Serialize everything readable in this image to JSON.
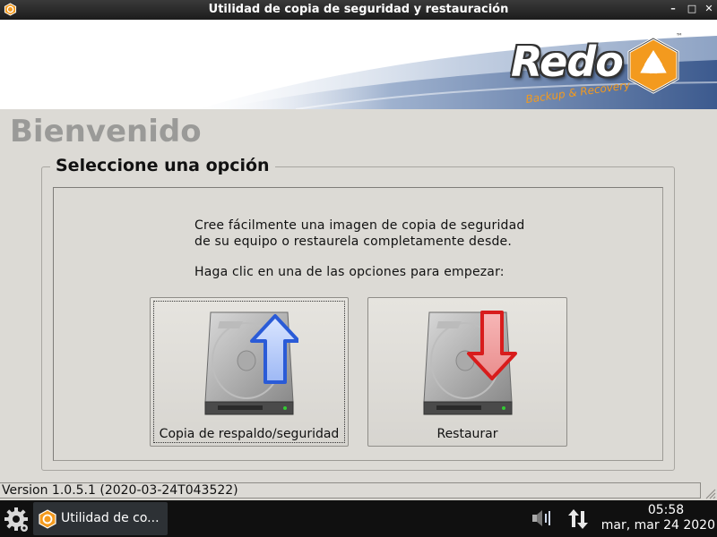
{
  "window": {
    "title": "Utilidad de copia de seguridad y restauración",
    "minimize_glyph": "–",
    "maximize_glyph": "□",
    "close_glyph": "✕"
  },
  "banner": {
    "logo_text": "Redo",
    "logo_sub": "Backup & Recovery",
    "logo_tm": "™"
  },
  "welcome": "Bienvenido",
  "group": {
    "title": "Seleccione una opción",
    "desc_line1": "Cree fácilmente una imagen de copia de seguridad",
    "desc_line2": "de su equipo o restaurela completamente desdе.",
    "instruction": "Haga clic en una de las opciones para empezar:"
  },
  "options": {
    "backup_label": "Copia de respaldo/seguridad",
    "restore_label": "Restaurar"
  },
  "status": {
    "version": "Version 1.0.5.1 (2020-03-24T043522)"
  },
  "taskbar": {
    "task_label": "Utilidad de co...",
    "time": "05:58",
    "date": "mar, mar 24 2020"
  },
  "colors": {
    "accent_orange": "#f39a1e",
    "arrow_blue": "#2a5bd7",
    "arrow_red": "#d81c1c",
    "banner_blue": "#3c5a8e"
  },
  "icons": {
    "app": "redo-logo-icon",
    "start": "gear-icon",
    "volume": "volume-icon",
    "network": "network-arrows-icon"
  }
}
